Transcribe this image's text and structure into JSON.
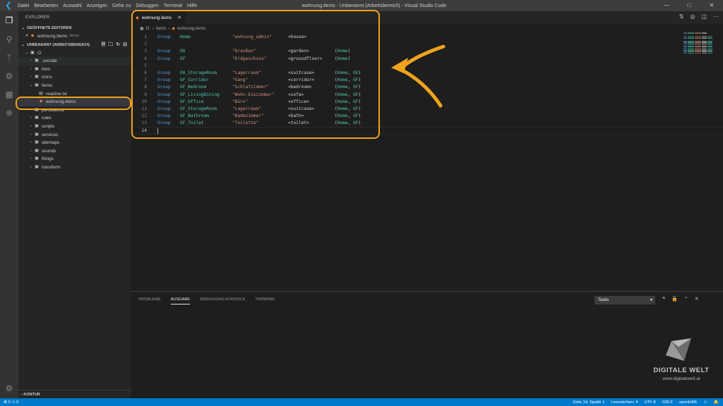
{
  "titlebar": {
    "menu": [
      "Datei",
      "Bearbeiten",
      "Auswahl",
      "Anzeigen",
      "Gehe zu",
      "Debuggen",
      "Terminal",
      "Hilfe"
    ],
    "title": "wohnung.items - Unbenannt (Arbeitsbereich) - Visual Studio Code"
  },
  "sidebar": {
    "header": "EXPLORER",
    "open_editors_label": "GEÖFFNETE EDITOREN",
    "open_editor": {
      "name": "wohnung.items",
      "folder": "items"
    },
    "workspace_label": "UNBENANNT (ARBEITSBEREICH)",
    "root": "O:",
    "tree": [
      {
        "name": ".vscode",
        "kind": "folder"
      },
      {
        "name": "html",
        "kind": "folder"
      },
      {
        "name": "icons",
        "kind": "folder"
      },
      {
        "name": "items",
        "kind": "folder"
      },
      {
        "name": "readme.txt",
        "kind": "file"
      },
      {
        "name": "wohnung.items",
        "kind": "items-file"
      },
      {
        "name": "persistence",
        "kind": "folder"
      },
      {
        "name": "rules",
        "kind": "folder"
      },
      {
        "name": "scripts",
        "kind": "folder"
      },
      {
        "name": "services",
        "kind": "folder"
      },
      {
        "name": "sitemaps",
        "kind": "folder"
      },
      {
        "name": "sounds",
        "kind": "folder"
      },
      {
        "name": "things",
        "kind": "folder"
      },
      {
        "name": "transform",
        "kind": "folder"
      }
    ],
    "outline_label": "KONTUR"
  },
  "editor": {
    "tab": "wohnung.items",
    "breadcrumb": [
      "O:",
      "items",
      "wohnung.items"
    ],
    "lines": [
      [
        "Group",
        "Home",
        "\"wohnung_admin\"",
        "<house>",
        ""
      ],
      [
        "",
        "",
        "",
        "",
        ""
      ],
      [
        "Group",
        "OU",
        "\"Draußen\"",
        "<garden>",
        "(Home)"
      ],
      [
        "Group",
        "GF",
        "\"Erdgeschoss\"",
        "<groundfloor>",
        "(Home)"
      ],
      [
        "",
        "",
        "",
        "",
        ""
      ],
      [
        "Group",
        "OU_StorageRoom",
        "\"Lagerraum\"",
        "<suitcase>",
        "(Home, OU)"
      ],
      [
        "Group",
        "GF_Corridor",
        "\"Gang\"",
        "<corridor>",
        "(Home, GF)"
      ],
      [
        "Group",
        "GF_Bedroom",
        "\"Schlafzimmer\"",
        "<bedroom>",
        "(Home, GF)"
      ],
      [
        "Group",
        "GF_LivingDining",
        "\"Wohn-Esszimmer\"",
        "<sofa>",
        "(Home, GF)"
      ],
      [
        "Group",
        "GF_Office",
        "\"Büro\"",
        "<office>",
        "(Home, GF)"
      ],
      [
        "Group",
        "GF_StorageRoom",
        "\"Lagerraum\"",
        "<suitcase>",
        "(Home, GF)"
      ],
      [
        "Group",
        "GF_Bathroom",
        "\"Badezimmer\"",
        "<bath>",
        "(Home, GF)"
      ],
      [
        "Group",
        "GF_Toilet",
        "\"Toilette\"",
        "<toilet>",
        "(Home, GF)"
      ],
      [
        "",
        "",
        "",
        "",
        ""
      ]
    ],
    "current_line": 14
  },
  "panel": {
    "tabs": [
      "PROBLEME",
      "AUSGABE",
      "DEBUGGING-KONSOLE",
      "TERMINAL"
    ],
    "active_tab": "AUSGABE",
    "output_channel": "Tasks"
  },
  "watermark": {
    "title": "DIGITALE WELT",
    "url": "www.digitalewelt.at"
  },
  "statusbar": {
    "errors": "0",
    "warnings": "0",
    "position": "Zeile 14, Spalte 1",
    "indent": "Leerzeichen: 4",
    "encoding": "UTF-8",
    "eol": "CRLF",
    "language": "openHAB"
  },
  "colors": {
    "accent": "#007acc",
    "highlight": "#f0a31c",
    "keyword": "#569cd6",
    "identifier": "#4ec9b0",
    "string": "#ce9178"
  }
}
